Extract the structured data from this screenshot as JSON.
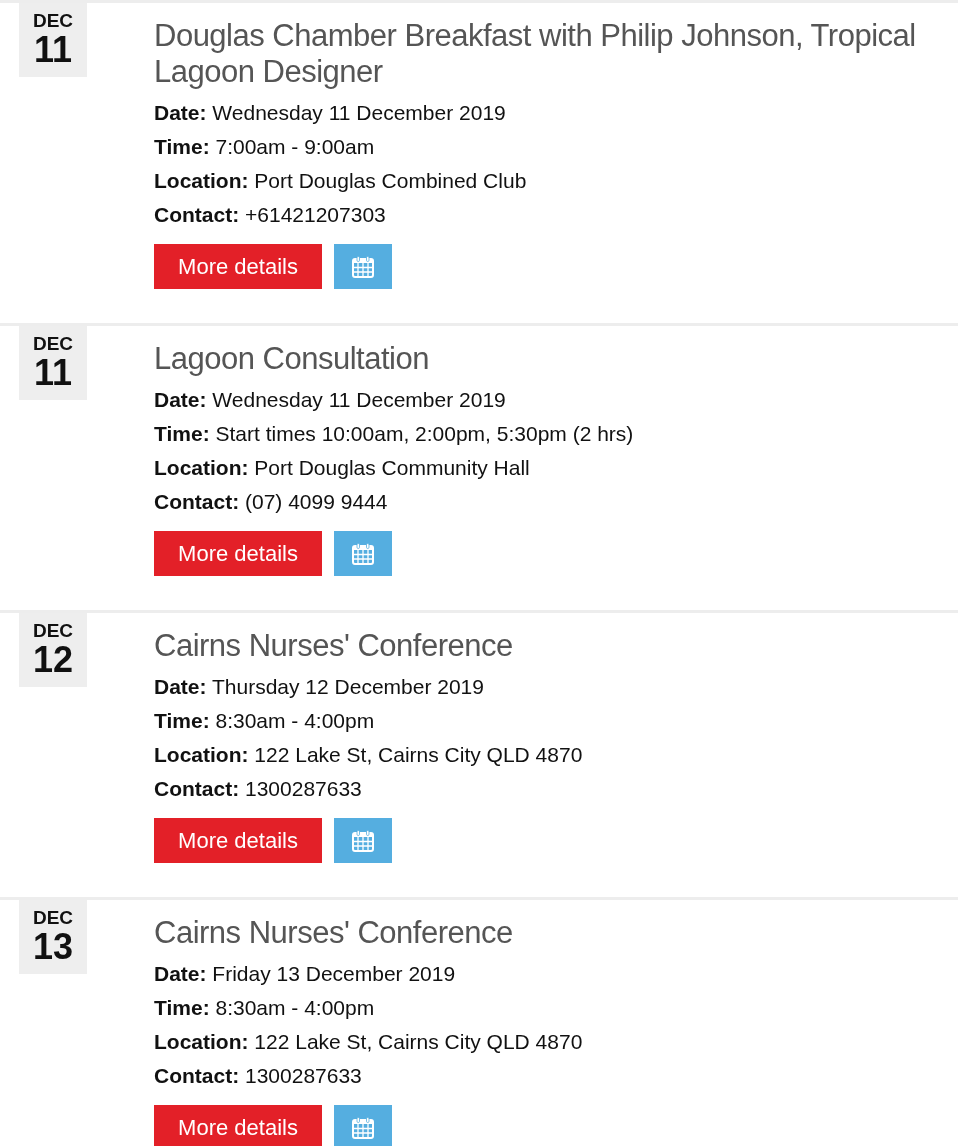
{
  "events": [
    {
      "month": "DEC",
      "day": "11",
      "title": "Douglas Chamber Breakfast with Philip Johnson, Tropical Lagoon Designer",
      "details": [
        {
          "label": "Date:",
          "value": "Wednesday 11 December 2019"
        },
        {
          "label": "Time:",
          "value": "7:00am - 9:00am"
        },
        {
          "label": "Location:",
          "value": "Port Douglas Combined Club"
        },
        {
          "label": "Contact:",
          "value": "+61421207303"
        }
      ],
      "button": "More details"
    },
    {
      "month": "DEC",
      "day": "11",
      "title": "Lagoon Consultation",
      "details": [
        {
          "label": "Date:",
          "value": "Wednesday 11 December 2019"
        },
        {
          "label": "Time:",
          "value": "Start times 10:00am, 2:00pm, 5:30pm (2 hrs)"
        },
        {
          "label": "Location:",
          "value": "Port Douglas Community Hall"
        },
        {
          "label": "Contact:",
          "value": "(07) 4099 9444"
        }
      ],
      "button": "More details"
    },
    {
      "month": "DEC",
      "day": "12",
      "title": "Cairns Nurses' Conference",
      "details": [
        {
          "label": "Date:",
          "value": "Thursday 12 December 2019"
        },
        {
          "label": "Time:",
          "value": "8:30am - 4:00pm"
        },
        {
          "label": "Location:",
          "value": "122 Lake St, Cairns City QLD 4870"
        },
        {
          "label": "Contact:",
          "value": "1300287633"
        }
      ],
      "button": "More details"
    },
    {
      "month": "DEC",
      "day": "13",
      "title": "Cairns Nurses' Conference",
      "details": [
        {
          "label": "Date:",
          "value": "Friday 13 December 2019"
        },
        {
          "label": "Time:",
          "value": "8:30am - 4:00pm"
        },
        {
          "label": "Location:",
          "value": "122 Lake St, Cairns City QLD 4870"
        },
        {
          "label": "Contact:",
          "value": "1300287633"
        }
      ],
      "button": "More details"
    }
  ]
}
